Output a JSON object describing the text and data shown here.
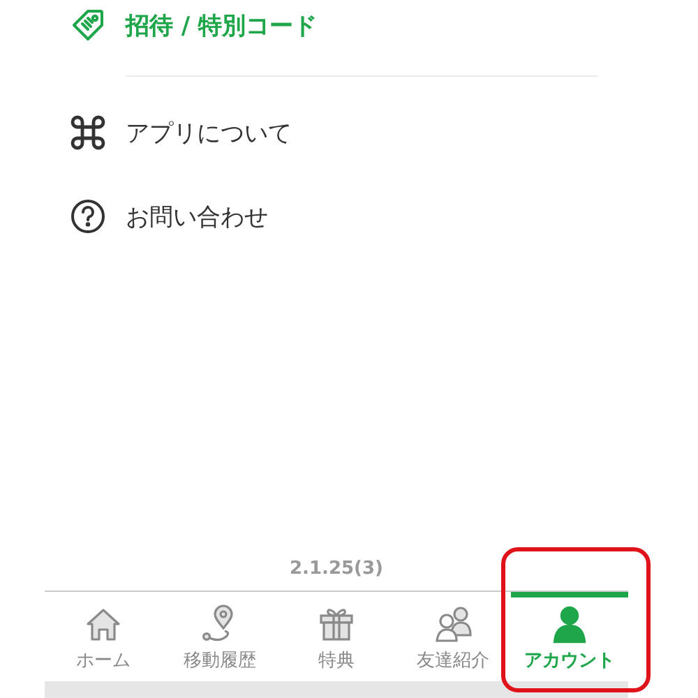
{
  "menu": [
    {
      "label": "招待 / 特別コード",
      "kind": "tag",
      "highlighted": true
    },
    {
      "label": "アプリについて",
      "kind": "command",
      "highlighted": false
    },
    {
      "label": "お問い合わせ",
      "kind": "help",
      "highlighted": false
    }
  ],
  "version": "2.1.25(3)",
  "tabs": [
    {
      "label": "ホーム",
      "kind": "home",
      "selected": false,
      "outlined": false
    },
    {
      "label": "移動履歴",
      "kind": "route",
      "selected": false,
      "outlined": false
    },
    {
      "label": "特典",
      "kind": "gift",
      "selected": false,
      "outlined": false
    },
    {
      "label": "友達紹介",
      "kind": "friends",
      "selected": false,
      "outlined": false
    },
    {
      "label": "アカウント",
      "kind": "person",
      "selected": true,
      "outlined": true
    }
  ]
}
